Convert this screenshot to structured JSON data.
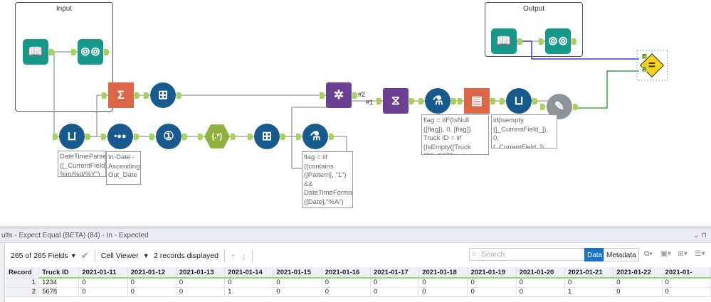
{
  "canvas": {
    "containers": [
      {
        "title": "Input"
      },
      {
        "title": "Output"
      }
    ],
    "tools": [
      {
        "name": "input-data-tool",
        "icon": "book-icon",
        "glyph": "📖",
        "cls": "teal"
      },
      {
        "name": "browse-tool",
        "icon": "binoculars-icon",
        "glyph": "⊚⊚",
        "cls": "teal"
      },
      {
        "name": "output-input-data-tool",
        "icon": "book-icon",
        "glyph": "📖",
        "cls": "teal"
      },
      {
        "name": "output-browse-tool",
        "icon": "binoculars-icon",
        "glyph": "⊚⊚",
        "cls": "teal"
      },
      {
        "name": "summarize-tool",
        "icon": "sigma-icon",
        "glyph": "Σ",
        "cls": "sq-orange"
      },
      {
        "name": "append-fields-tool",
        "icon": "append-icon",
        "glyph": "⊞",
        "cls": "circle"
      },
      {
        "name": "join-tool",
        "icon": "join-icon",
        "glyph": "✲",
        "cls": "sq-purple"
      },
      {
        "name": "transpose-tool",
        "icon": "dna-icon",
        "glyph": "⧖",
        "cls": "sq-purple"
      },
      {
        "name": "formula-tool",
        "icon": "flask-icon",
        "glyph": "⚗",
        "cls": "circle"
      },
      {
        "name": "crosstab-tool",
        "icon": "crosstab-icon",
        "glyph": "▤",
        "cls": "sq-orange"
      },
      {
        "name": "multi-field-formula-tool",
        "icon": "beaker-icon",
        "glyph": "⊔",
        "cls": "circle"
      },
      {
        "name": "expect-equal-macro",
        "icon": "pen-gear-icon",
        "glyph": "✎",
        "cls": "gear"
      },
      {
        "name": "multi-field-formula-tool-2",
        "icon": "beaker-icon",
        "glyph": "⊔",
        "cls": "circle"
      },
      {
        "name": "sort-tool",
        "icon": "dots-icon",
        "glyph": "•●●",
        "cls": "circle"
      },
      {
        "name": "record-id-tool",
        "icon": "numbered-icon",
        "glyph": "①",
        "cls": "circle"
      },
      {
        "name": "regex-tool",
        "icon": "regex-icon",
        "glyph": "(.*)",
        "cls": "hex"
      },
      {
        "name": "append-fields-tool-2",
        "icon": "append-icon",
        "glyph": "⊞",
        "cls": "circle"
      },
      {
        "name": "formula-tool-2",
        "icon": "flask-icon",
        "glyph": "⚗",
        "cls": "circle"
      }
    ],
    "expect_equal": {
      "glyph": "="
    },
    "join_labels": {
      "out2": "#2",
      "out1": "#1"
    },
    "annotations": [
      "DateTimeParse\n([_CurrentField_],\"\n%m/%d/%Y\")",
      "In-Date -\nAscending\nOut_Date -\nAscending",
      "flag = iif\n((contains\n([Pattern], \"1\")\n&&\nDateTimeFormat\n([Date],\"%A\")\n=\"Monday\") ||...",
      "flag = IIF(IsNull\n([flag]), 0, [flag])\nTruck ID = iif\n(IsEmpty([Truck\nID]), 5678, ...",
      "iif(isempty\n([_CurrentField_]),\n0,\n[_CurrentField_])"
    ]
  },
  "results": {
    "title": "ults - Expect Equal (BETA) (84) - In - Expected",
    "fields_label": "265 of 265 Fields",
    "cell_viewer": "Cell Viewer",
    "records_displayed": "2 records displayed",
    "search_placeholder": "Search",
    "data_tab": "Data",
    "metadata_tab": "Metadata",
    "columns": [
      "Record",
      "Truck ID",
      "2021-01-11",
      "2021-01-12",
      "2021-01-13",
      "2021-01-14",
      "2021-01-15",
      "2021-01-16",
      "2021-01-17",
      "2021-01-18",
      "2021-01-19",
      "2021-01-20",
      "2021-01-21",
      "2021-01-22",
      "2021-01-"
    ],
    "rows": [
      [
        "1",
        "1234",
        "0",
        "0",
        "0",
        "0",
        "0",
        "0",
        "0",
        "0",
        "0",
        "0",
        "0",
        "0",
        "0"
      ],
      [
        "2",
        "5678",
        "0",
        "0",
        "0",
        "1",
        "0",
        "0",
        "0",
        "0",
        "0",
        "0",
        "1",
        "0",
        "0"
      ]
    ],
    "accent": "#1a73c9"
  }
}
